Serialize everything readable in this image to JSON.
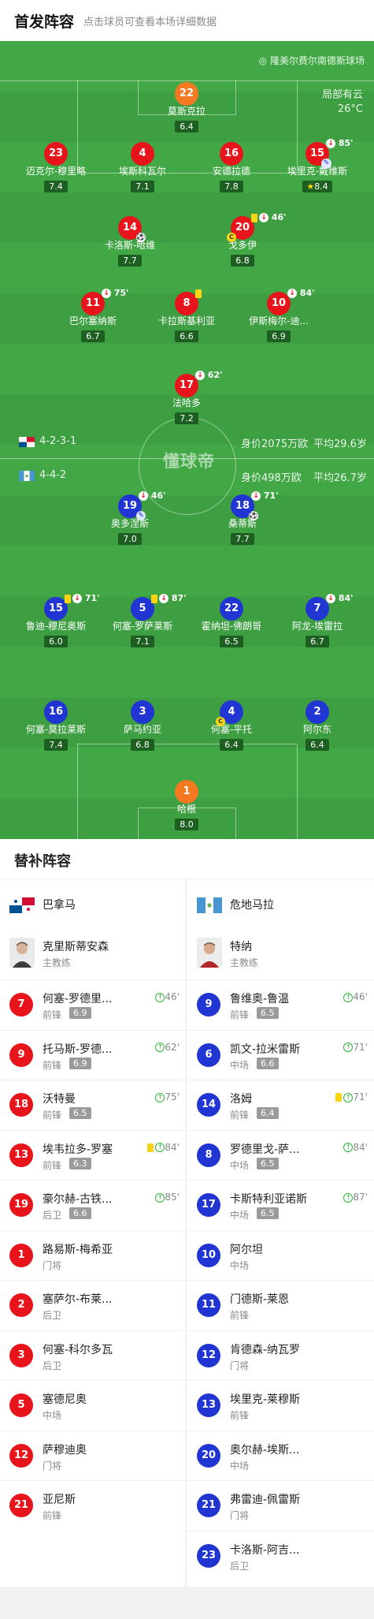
{
  "header": {
    "title": "首发阵容",
    "subtitle": "点击球员可查看本场详细数据"
  },
  "pitch": {
    "venue": "隆美尔费尔南德斯球场",
    "weather": "局部有云",
    "temperature": "26°C",
    "logo": "懂球帝",
    "home": {
      "formation": "4-2-3-1",
      "value": "身价2075万欧",
      "age": "平均29.6岁"
    },
    "away": {
      "formation": "4-4-2",
      "value": "身价498万欧",
      "age": "平均26.7岁"
    }
  },
  "home_players": [
    {
      "num": "22",
      "name": "莫斯克拉",
      "rating": "6.4",
      "gk": true
    },
    {
      "num": "23",
      "name": "迈克尔-穆里略",
      "rating": "7.4"
    },
    {
      "num": "4",
      "name": "埃斯科瓦尔",
      "rating": "7.1"
    },
    {
      "num": "16",
      "name": "安德拉德",
      "rating": "7.8"
    },
    {
      "num": "15",
      "name": "埃里克-戴维斯",
      "rating": "8.4",
      "sub": "85'",
      "star": true
    },
    {
      "num": "14",
      "name": "卡洛斯-哈维",
      "rating": "7.7",
      "goal": true
    },
    {
      "num": "20",
      "name": "戈多伊",
      "rating": "6.8",
      "sub": "46'",
      "yellow": true,
      "captain": true
    },
    {
      "num": "11",
      "name": "巴尔塞纳斯",
      "rating": "6.7",
      "sub": "75'"
    },
    {
      "num": "8",
      "name": "卡拉斯基利亚",
      "rating": "6.6",
      "yellow_only": true
    },
    {
      "num": "10",
      "name": "伊斯梅尔-迪...",
      "rating": "6.9",
      "sub": "84'"
    },
    {
      "num": "17",
      "name": "法哈多",
      "rating": "7.2",
      "sub": "62'"
    }
  ],
  "away_players": [
    {
      "num": "19",
      "name": "奥多涅斯",
      "rating": "7.0",
      "sub": "46'"
    },
    {
      "num": "18",
      "name": "桑蒂斯",
      "rating": "7.7",
      "sub": "71'",
      "goal": true
    },
    {
      "num": "15",
      "name": "鲁迪-穆尼奥斯",
      "rating": "6.0",
      "sub": "71'",
      "yellow": true
    },
    {
      "num": "5",
      "name": "何塞-罗萨莱斯",
      "rating": "7.1",
      "sub": "87'",
      "yellow": true
    },
    {
      "num": "22",
      "name": "霍纳坦-佛朗哥",
      "rating": "6.5"
    },
    {
      "num": "7",
      "name": "阿龙-埃雷拉",
      "rating": "6.7",
      "sub": "84'"
    },
    {
      "num": "16",
      "name": "何塞-莫拉莱斯",
      "rating": "7.4"
    },
    {
      "num": "3",
      "name": "萨马约亚",
      "rating": "6.8"
    },
    {
      "num": "4",
      "name": "何塞-平托",
      "rating": "6.4",
      "captain": true
    },
    {
      "num": "2",
      "name": "阿尔东",
      "rating": "6.4"
    },
    {
      "num": "1",
      "name": "哈根",
      "rating": "8.0",
      "gk": true
    }
  ],
  "subs": {
    "title": "替补阵容",
    "home": {
      "team": "巴拿马",
      "coach": {
        "name": "克里斯蒂安森",
        "role": "主教练"
      },
      "players": [
        {
          "num": "7",
          "name": "何塞-罗德里...",
          "pos": "前锋",
          "rating": "6.9",
          "min": "46'"
        },
        {
          "num": "9",
          "name": "托马斯-罗德...",
          "pos": "前锋",
          "rating": "6.9",
          "min": "62'"
        },
        {
          "num": "18",
          "name": "沃特曼",
          "pos": "前锋",
          "rating": "6.5",
          "min": "75'"
        },
        {
          "num": "13",
          "name": "埃韦拉多-罗塞",
          "pos": "前锋",
          "rating": "6.3",
          "min": "84'",
          "yellow": true
        },
        {
          "num": "19",
          "name": "豪尔赫-古铁...",
          "pos": "后卫",
          "rating": "6.6",
          "min": "85'"
        },
        {
          "num": "1",
          "name": "路易斯-梅希亚",
          "pos": "门将"
        },
        {
          "num": "2",
          "name": "塞萨尔-布莱...",
          "pos": "后卫"
        },
        {
          "num": "3",
          "name": "何塞-科尔多瓦",
          "pos": "后卫"
        },
        {
          "num": "5",
          "name": "塞德尼奥",
          "pos": "中场"
        },
        {
          "num": "12",
          "name": "萨穆迪奥",
          "pos": "门将"
        },
        {
          "num": "21",
          "name": "亚尼斯",
          "pos": "前锋"
        }
      ]
    },
    "away": {
      "team": "危地马拉",
      "coach": {
        "name": "特纳",
        "role": "主教练"
      },
      "players": [
        {
          "num": "9",
          "name": "鲁维奥-鲁温",
          "pos": "前锋",
          "rating": "6.5",
          "min": "46'"
        },
        {
          "num": "6",
          "name": "凯文-拉米雷斯",
          "pos": "中场",
          "rating": "6.6",
          "min": "71'"
        },
        {
          "num": "14",
          "name": "洛姆",
          "pos": "前锋",
          "rating": "6.4",
          "min": "71'",
          "yellow": true
        },
        {
          "num": "8",
          "name": "罗德里戈-萨...",
          "pos": "中场",
          "rating": "6.5",
          "min": "84'"
        },
        {
          "num": "17",
          "name": "卡斯特利亚诺斯",
          "pos": "中场",
          "rating": "6.5",
          "min": "87'"
        },
        {
          "num": "10",
          "name": "阿尔坦",
          "pos": "中场"
        },
        {
          "num": "11",
          "name": "门德斯-莱恩",
          "pos": "前锋"
        },
        {
          "num": "12",
          "name": "肯德森-纳瓦罗",
          "pos": "门将"
        },
        {
          "num": "13",
          "name": "埃里克-莱穆斯",
          "pos": "前锋"
        },
        {
          "num": "20",
          "name": "奥尔赫-埃斯...",
          "pos": "中场"
        },
        {
          "num": "21",
          "name": "弗雷迪-佩雷斯",
          "pos": "门将"
        },
        {
          "num": "23",
          "name": "卡洛斯-阿吉...",
          "pos": "后卫"
        }
      ]
    }
  },
  "colors": {
    "home": "#e8141c",
    "away": "#2135d3",
    "gk": "#f47920",
    "pitch": "#41a845"
  }
}
